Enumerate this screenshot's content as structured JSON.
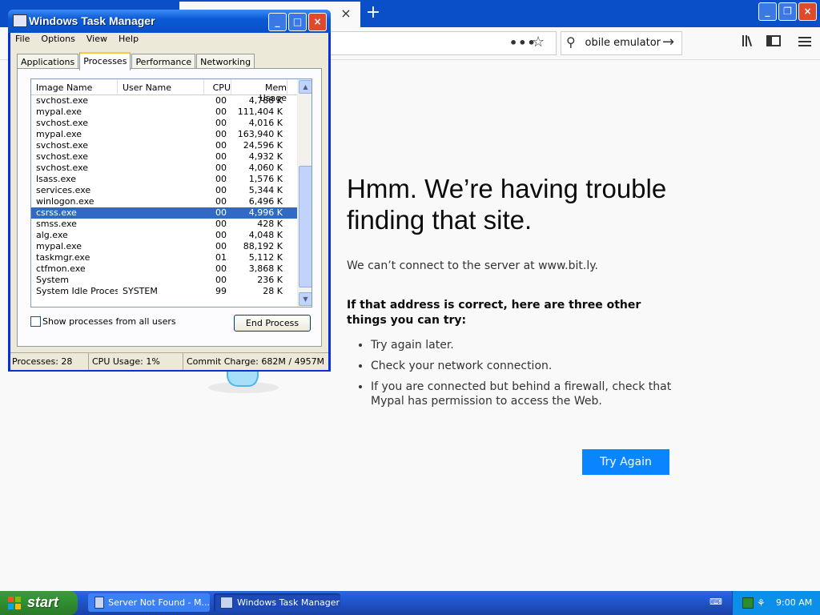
{
  "browser": {
    "tab_close": "×",
    "new_tab": "+",
    "search_value": "mobile emulator",
    "window_buttons": [
      "_",
      "❐",
      "×"
    ]
  },
  "error_page": {
    "title": "Hmm. We’re having trouble finding that site.",
    "description": "We can’t connect to the server at www.bit.ly.",
    "subtitle": "If that address is correct, here are three other things you can try:",
    "tips": [
      "Try again later.",
      "Check your network connection.",
      "If you are connected but behind a firewall, check that Mypal has permission to access the Web."
    ],
    "try_again_label": "Try Again"
  },
  "task_manager": {
    "title": "Windows Task Manager",
    "menu": [
      "File",
      "Options",
      "View",
      "Help"
    ],
    "tabs": [
      "Applications",
      "Processes",
      "Performance",
      "Networking"
    ],
    "active_tab": "Processes",
    "columns": [
      "Image Name",
      "User Name",
      "CPU",
      "Mem Usage"
    ],
    "processes": [
      {
        "name": "svchost.exe",
        "user": "",
        "cpu": "00",
        "mem": "4,788 K"
      },
      {
        "name": "mypal.exe",
        "user": "",
        "cpu": "00",
        "mem": "111,404 K"
      },
      {
        "name": "svchost.exe",
        "user": "",
        "cpu": "00",
        "mem": "4,016 K"
      },
      {
        "name": "mypal.exe",
        "user": "",
        "cpu": "00",
        "mem": "163,940 K"
      },
      {
        "name": "svchost.exe",
        "user": "",
        "cpu": "00",
        "mem": "24,596 K"
      },
      {
        "name": "svchost.exe",
        "user": "",
        "cpu": "00",
        "mem": "4,932 K"
      },
      {
        "name": "svchost.exe",
        "user": "",
        "cpu": "00",
        "mem": "4,060 K"
      },
      {
        "name": "lsass.exe",
        "user": "",
        "cpu": "00",
        "mem": "1,576 K"
      },
      {
        "name": "services.exe",
        "user": "",
        "cpu": "00",
        "mem": "5,344 K"
      },
      {
        "name": "winlogon.exe",
        "user": "",
        "cpu": "00",
        "mem": "6,496 K"
      },
      {
        "name": "csrss.exe",
        "user": "",
        "cpu": "00",
        "mem": "4,996 K"
      },
      {
        "name": "smss.exe",
        "user": "",
        "cpu": "00",
        "mem": "428 K"
      },
      {
        "name": "alg.exe",
        "user": "",
        "cpu": "00",
        "mem": "4,048 K"
      },
      {
        "name": "mypal.exe",
        "user": "",
        "cpu": "00",
        "mem": "88,192 K"
      },
      {
        "name": "taskmgr.exe",
        "user": "",
        "cpu": "01",
        "mem": "5,112 K"
      },
      {
        "name": "ctfmon.exe",
        "user": "",
        "cpu": "00",
        "mem": "3,868 K"
      },
      {
        "name": "System",
        "user": "",
        "cpu": "00",
        "mem": "236 K"
      },
      {
        "name": "System Idle Process",
        "user": "SYSTEM",
        "cpu": "99",
        "mem": "28 K"
      }
    ],
    "selected_process": "csrss.exe",
    "show_all_label": "Show processes from all users",
    "end_process_label": "End Process",
    "status": {
      "processes": "Processes: 28",
      "cpu": "CPU Usage: 1%",
      "commit": "Commit Charge: 682M / 4957M"
    }
  },
  "taskbar": {
    "start_label": "start",
    "items": [
      "Server Not Found - M...",
      "Windows Task Manager"
    ],
    "active_item": "Windows Task Manager",
    "clock": "9:00 AM"
  },
  "colors": {
    "xp_blue": "#0a4ec8",
    "try_again": "#0a84ff",
    "selection": "#316ac5",
    "start_green": "#2f8e2f"
  }
}
